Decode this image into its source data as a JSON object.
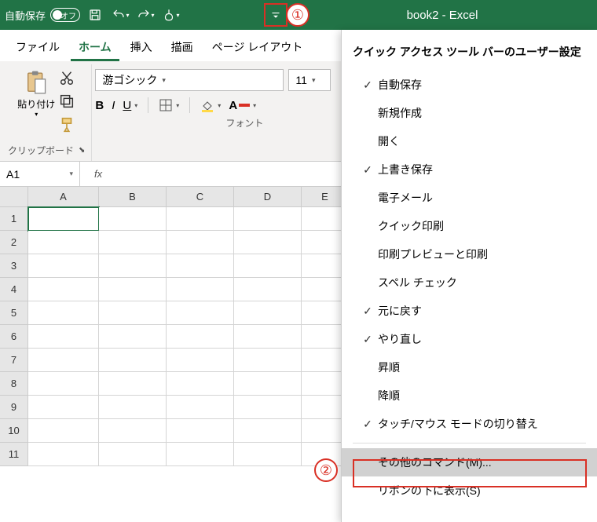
{
  "title": "book2 - Excel",
  "autosave": {
    "label": "自動保存",
    "toggle_text": "オフ"
  },
  "tabs": {
    "file": "ファイル",
    "home": "ホーム",
    "insert": "挿入",
    "draw": "描画",
    "pagelayout": "ページ レイアウト"
  },
  "clipboard": {
    "paste": "貼り付け",
    "group_label": "クリップボード"
  },
  "font": {
    "name": "游ゴシック",
    "size": "11",
    "group_label": "フォント"
  },
  "namebox": "A1",
  "fx_label": "fx",
  "columns": [
    "A",
    "B",
    "C",
    "D",
    "E"
  ],
  "rows": [
    "1",
    "2",
    "3",
    "4",
    "5",
    "6",
    "7",
    "8",
    "9",
    "10",
    "11"
  ],
  "menu": {
    "title": "クイック アクセス ツール バーのユーザー設定",
    "items": [
      {
        "label": "自動保存",
        "checked": true
      },
      {
        "label": "新規作成",
        "checked": false
      },
      {
        "label": "開く",
        "checked": false
      },
      {
        "label": "上書き保存",
        "checked": true
      },
      {
        "label": "電子メール",
        "checked": false
      },
      {
        "label": "クイック印刷",
        "checked": false
      },
      {
        "label": "印刷プレビューと印刷",
        "checked": false
      },
      {
        "label": "スペル チェック",
        "checked": false
      },
      {
        "label": "元に戻す",
        "checked": true
      },
      {
        "label": "やり直し",
        "checked": true
      },
      {
        "label": "昇順",
        "checked": false
      },
      {
        "label": "降順",
        "checked": false
      },
      {
        "label": "タッチ/マウス モードの切り替え",
        "checked": true
      }
    ],
    "more_commands": "その他のコマンド(M)...",
    "show_below": "リボンの下に表示(S)"
  },
  "annotations": {
    "one": "①",
    "two": "②"
  }
}
